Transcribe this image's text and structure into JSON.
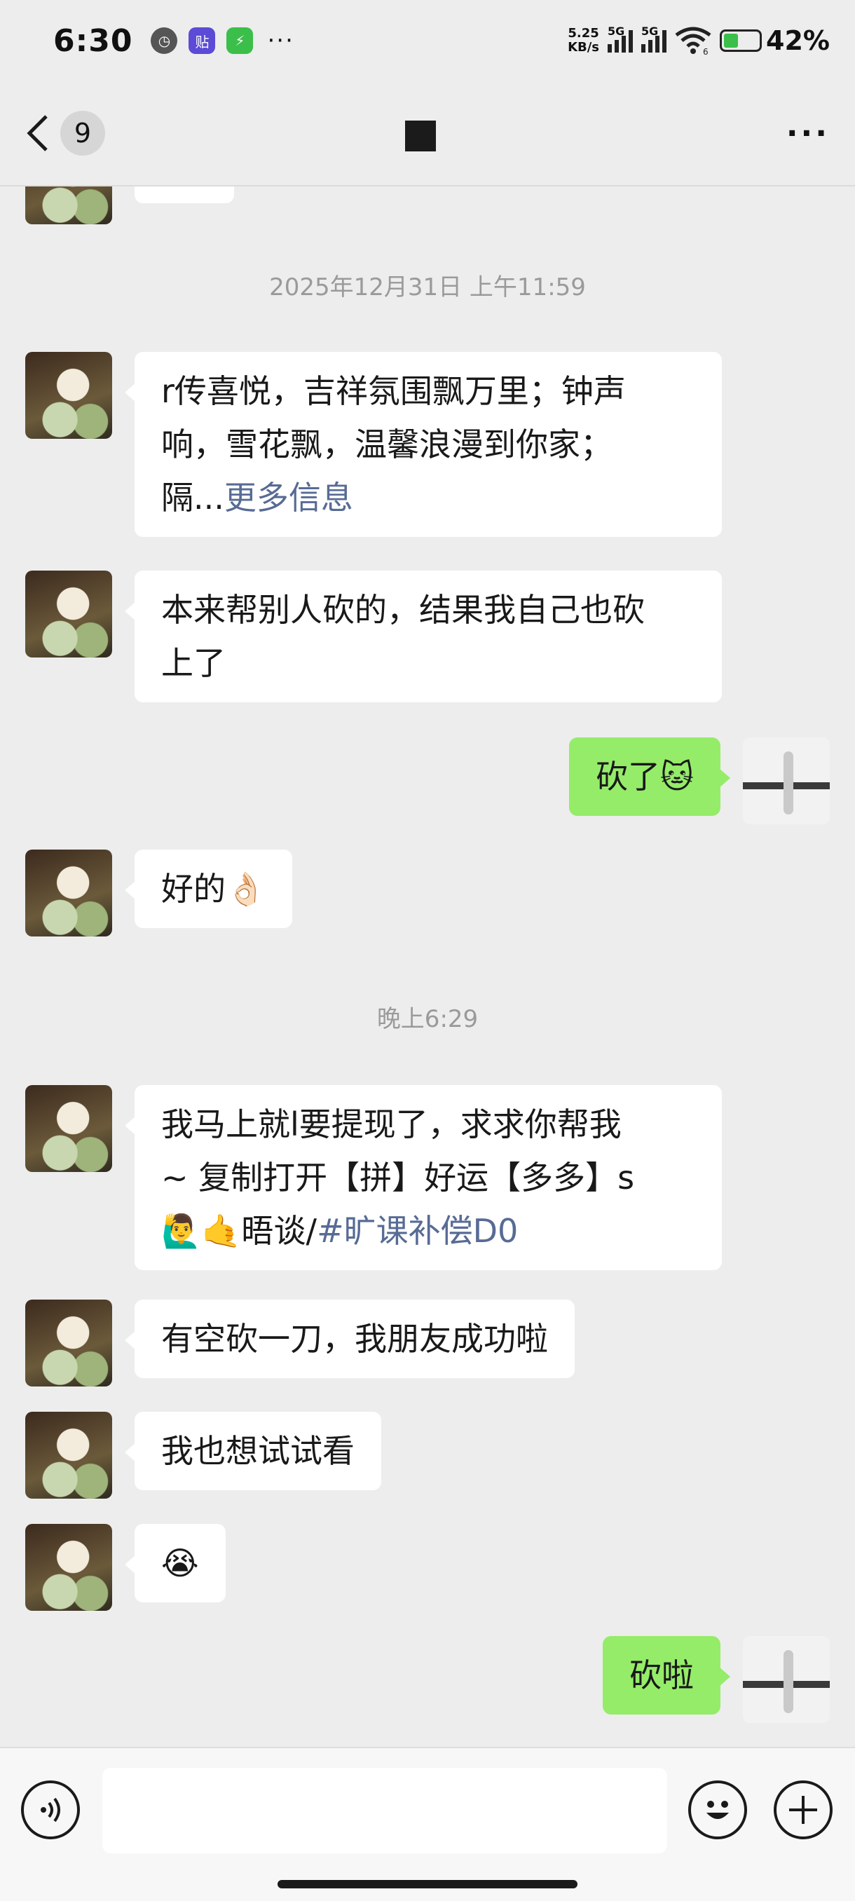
{
  "status_bar": {
    "time": "6:30",
    "icons": [
      "clock-app-icon",
      "tieba-app-icon",
      "bolt-app-icon"
    ],
    "more": "···",
    "net_speed_value": "5.25",
    "net_speed_unit": "KB/s",
    "signal1_label": "5G",
    "signal2_label": "5G",
    "wifi_label": "6",
    "battery_percent": "42%",
    "battery_level": 0.42
  },
  "header": {
    "unread_count": "9",
    "more": "···"
  },
  "chat": {
    "timestamp1": "2025年12月31日 上午11:59",
    "msg1_line1": "r传喜悦，吉祥氛围飘万里；钟声",
    "msg1_line2": "响，雪花飘，温馨浪漫到你家；",
    "msg1_line3_prefix": "隔...",
    "msg1_more": "更多信息",
    "msg2_line1": "本来帮别人砍的，结果我自己也砍",
    "msg2_line2": "上了",
    "msg3_text": "砍了",
    "msg3_emoji": "🐱",
    "msg4_text": "好的",
    "msg4_emoji": "👌🏻",
    "timestamp2": "晚上6:29",
    "msg5_line1": "我马上就l要提现了，求求你帮我",
    "msg5_line2": "~ 复制打开【拼】好运【多多】s",
    "msg5_line3_prefix": "🙋‍♂️🤙晤谈/",
    "msg5_tag": "#旷课补偿D0",
    "msg6_text": "有空砍一刀，我朋友成功啦",
    "msg7_text": "我也想试试看",
    "msg8_emoji": "😭",
    "msg9_text": "砍啦"
  },
  "input_bar": {
    "input_value": "",
    "icons": [
      "voice-icon",
      "mic-icon",
      "emoji-icon",
      "plus-icon"
    ]
  }
}
